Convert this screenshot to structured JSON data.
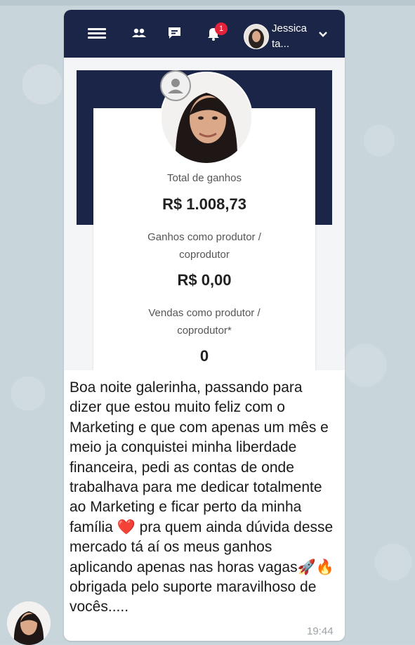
{
  "navbar": {
    "user_name": "Jessica ta...",
    "notification_count": "1"
  },
  "dashboard": {
    "total_label": "Total de ganhos",
    "total_value": "R$ 1.008,73",
    "producer_label_1": "Ganhos como produtor /",
    "producer_label_2": "coprodutor",
    "producer_value": "R$ 0,00",
    "sales_label_1": "Vendas como produtor /",
    "sales_label_2": "coprodutor*",
    "sales_value": "0"
  },
  "message": {
    "text": "Boa noite galerinha, passando para dizer que estou muito feliz com o Marketing e que com apenas um mês e meio ja conquistei minha liberdade financeira, pedi as contas de onde trabalhava para me dedicar totalmente ao Marketing e ficar perto da minha família ❤️ pra quem ainda dúvida desse mercado tá aí os meus ganhos aplicando apenas nas horas vagas🚀🔥 obrigada pelo suporte maravilhoso de vocês.....",
    "time": "19:44"
  },
  "colors": {
    "navy": "#1b2547",
    "badge_red": "#e2233a",
    "chat_bg": "#c8d5db"
  }
}
